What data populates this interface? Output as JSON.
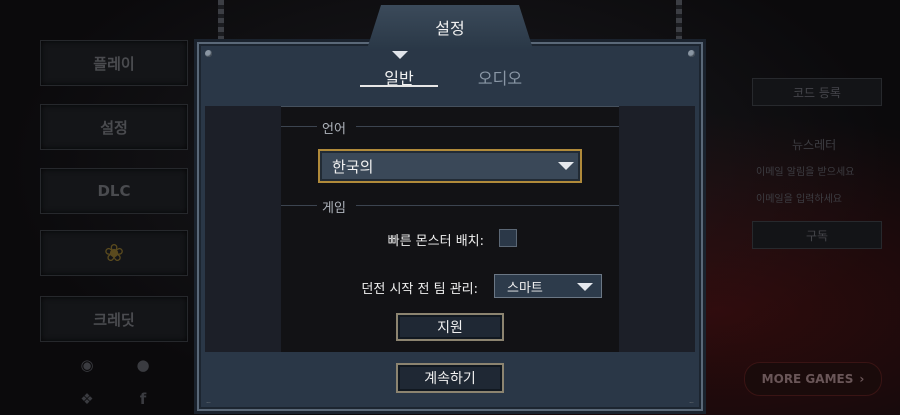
{
  "background_menu": {
    "items": [
      {
        "label": "플레이"
      },
      {
        "label": "설정"
      },
      {
        "label": "DLC"
      },
      {
        "icon": "ribbon-badge-icon"
      },
      {
        "label": "크레딧"
      }
    ],
    "right": {
      "code_register": "코드 등록",
      "newsletter": "뉴스레터",
      "newsletter_line1": "이메일 알림을 받으세요",
      "newsletter_line2": "이메일을 입력하세요",
      "subscribe": "구독",
      "more_games": "MORE GAMES"
    }
  },
  "dialog": {
    "title": "설정",
    "tabs": [
      {
        "label": "일반",
        "active": true
      },
      {
        "label": "오디오",
        "active": false
      }
    ],
    "language_section": {
      "label": "언어",
      "selected": "한국의"
    },
    "game_section": {
      "label": "게임",
      "fast_monster_label": "빠른 몬스터 배치:",
      "fast_monster_checked": false,
      "team_manage_label": "던전 시작 전 팀 관리:",
      "team_manage_value": "스마트",
      "support_button": "지원"
    },
    "continue_button": "계속하기"
  },
  "colors": {
    "panel": "#2a3747",
    "content": "#121215",
    "gold_border": "#b08a3a"
  }
}
